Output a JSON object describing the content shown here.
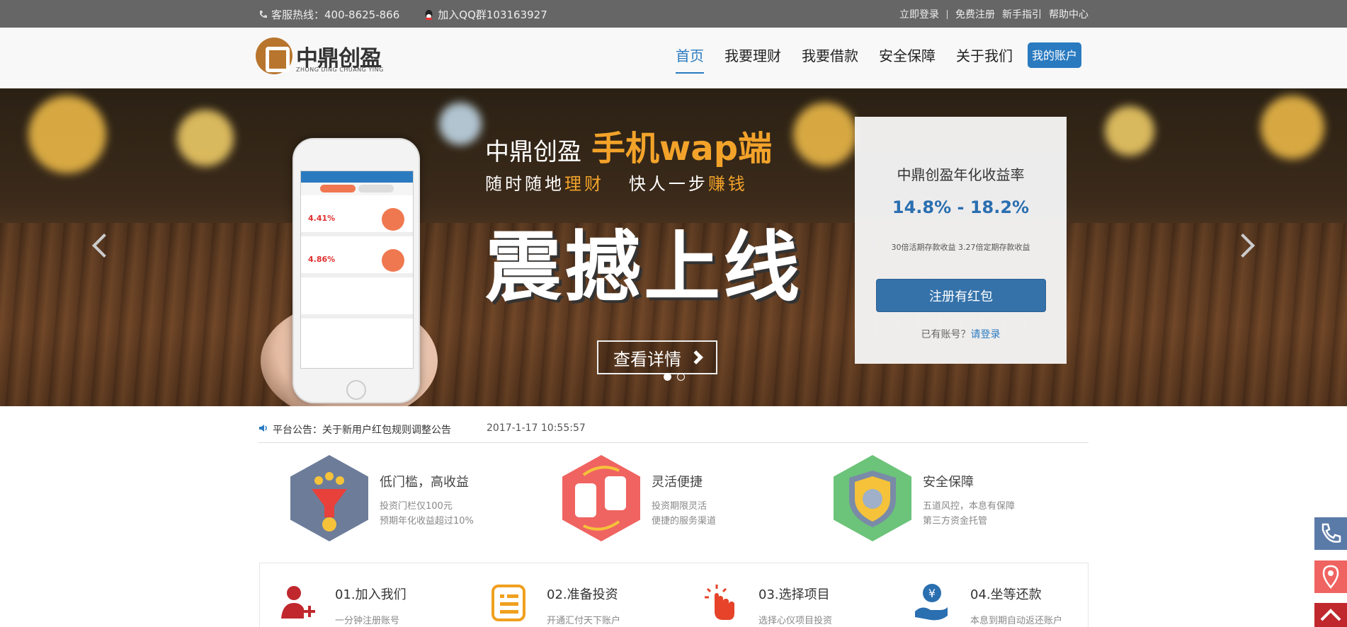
{
  "topbar": {
    "hotline": "客服热线：400-8625-866",
    "qq": "加入QQ群103163927",
    "links": [
      "立即登录",
      "免费注册",
      "新手指引",
      "帮助中心"
    ]
  },
  "header": {
    "logo_text": "中鼎创盈",
    "logo_sub": "ZHONG DING CHUANG YING",
    "nav": [
      "首页",
      "我要理财",
      "我要借款",
      "安全保障",
      "关于我们"
    ],
    "account": "我的账户"
  },
  "banner": {
    "brand": "中鼎创盈",
    "wap": "手机wap端",
    "slogan_a": "随时随地",
    "slogan_b": "理财",
    "slogan_c": "快人一步",
    "slogan_d": "赚钱",
    "headline": "震撼上线",
    "detail_btn": "查看详情",
    "phone_rates": [
      "4.41%",
      "4.86%"
    ],
    "reg": {
      "title": "中鼎创盈年化收益率",
      "rate": "14.8% - 18.2%",
      "note": "30倍活期存款收益 3.27倍定期存款收益",
      "button": "注册有红包",
      "login_q": "已有账号？",
      "login_link": "请登录"
    }
  },
  "notice": {
    "text": "平台公告：关于新用户红包规则调整公告",
    "time": "2017-1-17 10:55:57"
  },
  "features": [
    {
      "title": "低门槛，高收益",
      "d1": "投资门栏仅100元",
      "d2": "预期年化收益超过10%",
      "color": "#6d7d99"
    },
    {
      "title": "灵活便捷",
      "d1": "投资期限灵活",
      "d2": "便捷的服务渠道",
      "color": "#ef6461"
    },
    {
      "title": "安全保障",
      "d1": "五道风控，本息有保障",
      "d2": "第三方资金托管",
      "color": "#6cc37a"
    }
  ],
  "steps": [
    {
      "title": "01.加入我们",
      "desc": "一分钟注册账号"
    },
    {
      "title": "02.准备投资",
      "desc": "开通汇付天下账户"
    },
    {
      "title": "03.选择项目",
      "desc": "选择心仪项目投资"
    },
    {
      "title": "04.坐等还款",
      "desc": "本息到期自动返还账户"
    }
  ],
  "colors": {
    "brand_blue": "#2a7ac0",
    "accent_orange": "#f3a32a",
    "topbar": "#666666",
    "logo": "#b8752d"
  }
}
